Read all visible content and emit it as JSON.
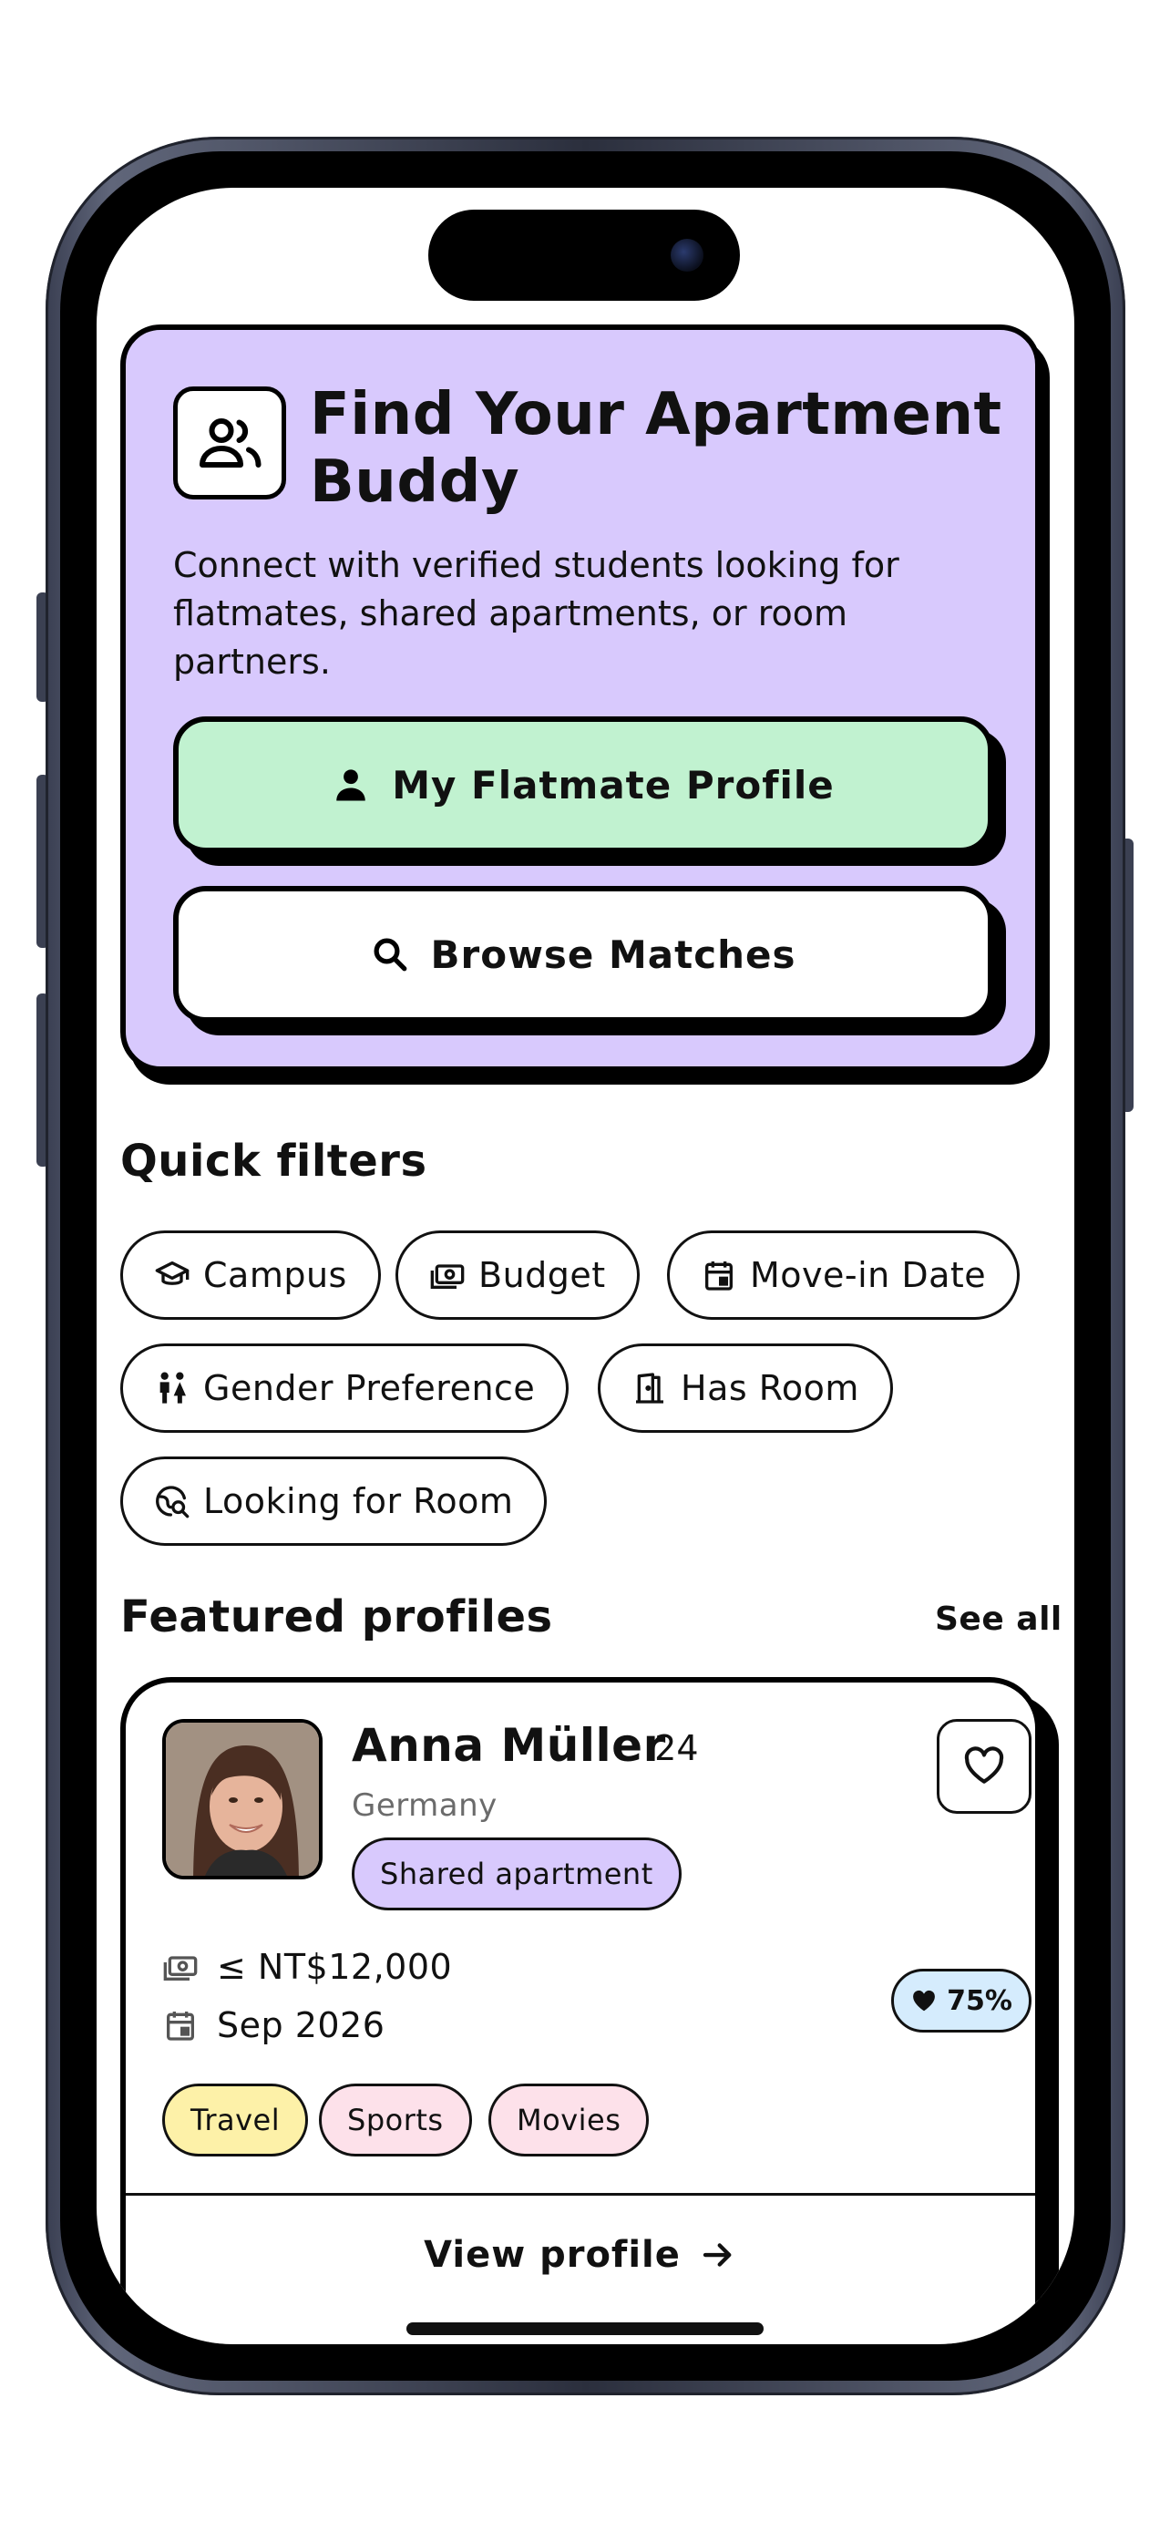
{
  "hero": {
    "title": "Find Your Apartment Buddy",
    "description": "Connect with verified students looking for flatmates, shared apartments, or room partners.",
    "primary_button": "My Flatmate Profile",
    "secondary_button": "Browse Matches",
    "icon": "users-icon",
    "bg_color": "#d8c9fd"
  },
  "quick_filters": {
    "title": "Quick filters",
    "chips": [
      {
        "label": "Campus",
        "icon": "graduation-cap-icon"
      },
      {
        "label": "Budget",
        "icon": "money-icon"
      },
      {
        "label": "Move-in Date",
        "icon": "calendar-icon"
      },
      {
        "label": "Gender Preference",
        "icon": "people-icon"
      },
      {
        "label": "Has Room",
        "icon": "door-icon"
      },
      {
        "label": "Looking for Room",
        "icon": "globe-search-icon"
      }
    ]
  },
  "featured": {
    "title": "Featured profiles",
    "see_all": "See all",
    "profile": {
      "name": "Anna Müller",
      "age": "· 24",
      "country": "Germany",
      "type_tag": "Shared apartment",
      "budget": "≤ NT$12,000",
      "move_in": "Sep 2026",
      "match": "75%",
      "interests": [
        {
          "label": "Travel",
          "color": "#fdf1a8"
        },
        {
          "label": "Sports",
          "color": "#fde1ea"
        },
        {
          "label": "Movies",
          "color": "#fde1ea"
        }
      ],
      "view_profile": "View profile"
    }
  },
  "colors": {
    "green_cta": "#c1f2d0",
    "lavender": "#d8c9fd",
    "match_blue": "#d5ecfd"
  }
}
